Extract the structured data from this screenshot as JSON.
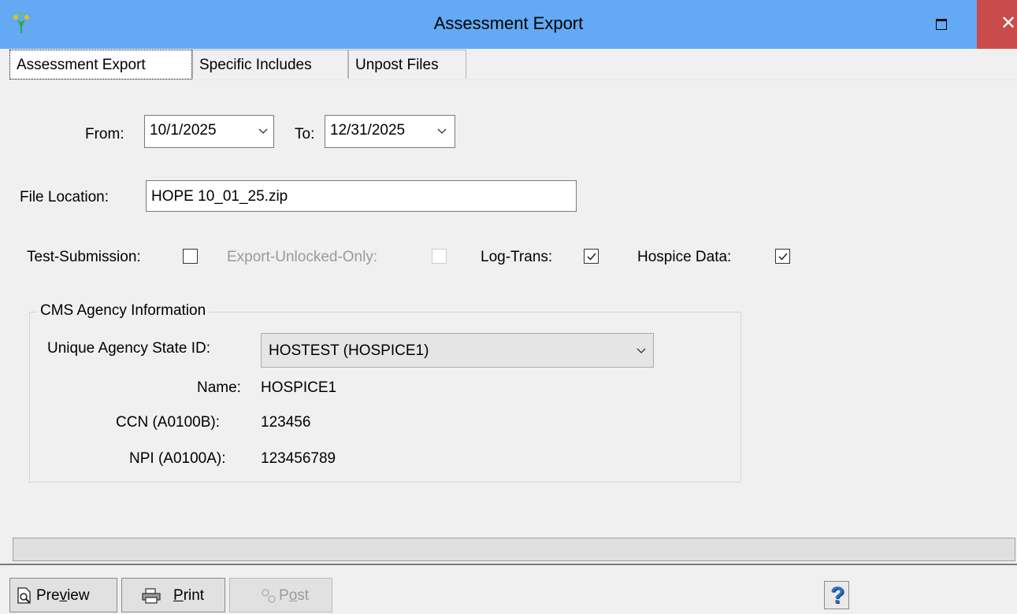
{
  "window": {
    "title": "Assessment Export",
    "close_glyph": "✕",
    "maximize_icon": "maximize-icon",
    "app_icon": "app-logo-icon"
  },
  "tabs": [
    {
      "label": "Assessment Export",
      "active": true
    },
    {
      "label": "Specific Includes",
      "active": false
    },
    {
      "label": "Unpost Files",
      "active": false
    }
  ],
  "dates": {
    "from_label": "From:",
    "from_value": "10/1/2025",
    "to_label": "To:",
    "to_value": "12/31/2025"
  },
  "file": {
    "label": "File Location:",
    "value": "HOPE 10_01_25.zip"
  },
  "options": [
    {
      "label": "Test-Submission:",
      "checked": false,
      "enabled": true
    },
    {
      "label": "Export-Unlocked-Only:",
      "checked": false,
      "enabled": false
    },
    {
      "label": "Log-Trans:",
      "checked": true,
      "enabled": true
    },
    {
      "label": "Hospice Data:",
      "checked": true,
      "enabled": true
    }
  ],
  "agency": {
    "group_title": "CMS Agency Information",
    "state_id_label": "Unique Agency State ID:",
    "state_id_value": "HOSTEST (HOSPICE1)",
    "name_label": "Name:",
    "name_value": "HOSPICE1",
    "ccn_label": "CCN (A0100B):",
    "ccn_value": "123456",
    "npi_label": "NPI (A0100A):",
    "npi_value": "123456789"
  },
  "buttons": {
    "preview": {
      "pre": "Pre",
      "ul": "v",
      "post": "iew",
      "enabled": true
    },
    "print": {
      "pre": "",
      "ul": "P",
      "post": "rint",
      "enabled": true
    },
    "post": {
      "pre": "P",
      "ul": "o",
      "post": "st",
      "enabled": false
    },
    "help": "?"
  },
  "colors": {
    "titlebar": "#63a9f3",
    "close": "#c94b4b",
    "help_icon": "#2a6fc9"
  }
}
